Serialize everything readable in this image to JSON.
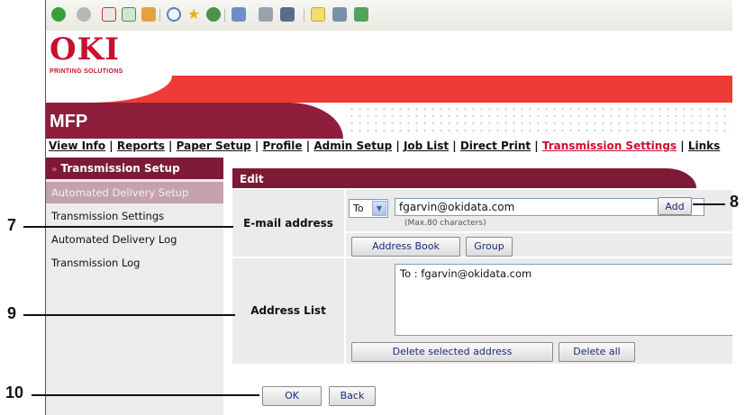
{
  "brand": {
    "logo": "OKI",
    "tagline": "PRINTING SOLUTIONS",
    "product": "MFP"
  },
  "toolbar_icons": [
    "back-icon",
    "forward-icon",
    "stop-icon",
    "refresh-icon",
    "home-icon",
    "search-icon",
    "favorites-icon",
    "history-icon",
    "mail-icon",
    "print-icon",
    "edit-icon",
    "discuss-icon",
    "research-icon",
    "messenger-icon"
  ],
  "nav": {
    "items": [
      "View Info",
      "Reports",
      "Paper Setup",
      "Profile",
      "Admin Setup",
      "Job List",
      "Direct Print",
      "Transmission Settings",
      "Links"
    ],
    "separator": "|",
    "active": "Transmission Settings"
  },
  "sidebar": {
    "heading": "Transmission Setup",
    "items": [
      "Automated Delivery Setup",
      "Transmission Settings",
      "Automated Delivery Log",
      "Transmission Log"
    ]
  },
  "edit": {
    "title": "Edit",
    "email_label": "E-mail address",
    "recipient_type": "To",
    "email_value": "fgarvin@okidata.com",
    "email_hint": "(Max.80 characters)",
    "add_label": "Add",
    "address_book_label": "Address Book",
    "group_label": "Group",
    "list_label": "Address List",
    "list_entries": [
      "To : fgarvin@okidata.com"
    ],
    "delete_selected_label": "Delete selected address",
    "delete_all_label": "Delete all",
    "ok_label": "OK",
    "back_label": "Back"
  },
  "callouts": {
    "c7": "7",
    "c8": "8",
    "c9": "9",
    "c10": "10"
  },
  "colors": {
    "brand_red": "#ee3b36",
    "maroon": "#7d1a36",
    "active_link": "#c8102e"
  }
}
